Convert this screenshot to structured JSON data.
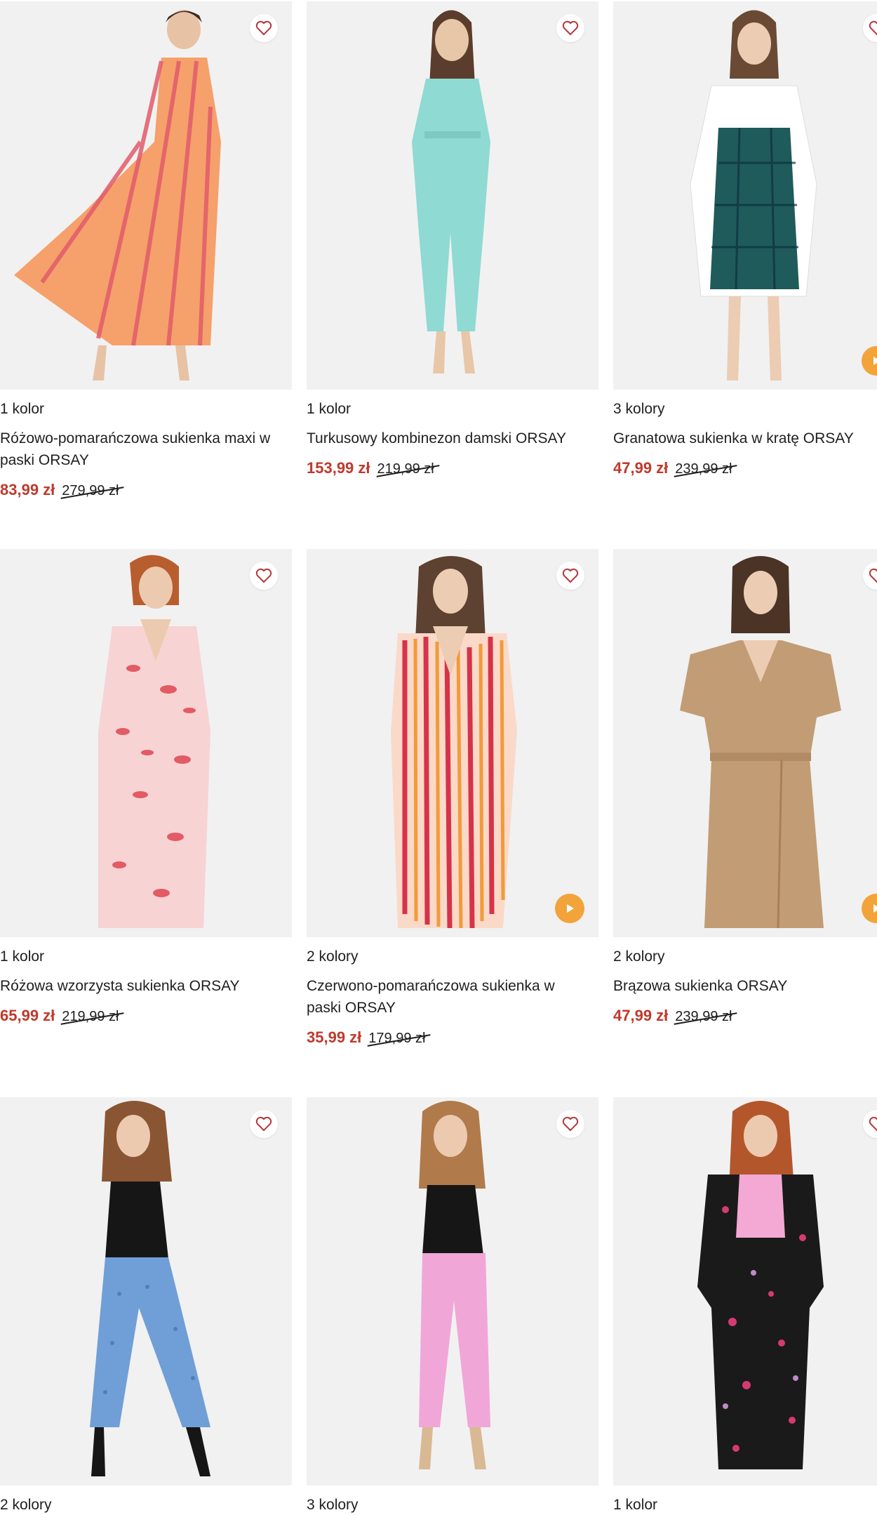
{
  "products": [
    {
      "colors": "1 kolor",
      "name": "Różowo-pomarańczowa sukienka maxi w paski ORSAY",
      "price": "83,99 zł",
      "old_price": "279,99 zł",
      "icon": "heart-icon",
      "has_video": false
    },
    {
      "colors": "1 kolor",
      "name": "Turkusowy kombinezon damski ORSAY",
      "price": "153,99 zł",
      "old_price": "219,99 zł",
      "icon": "heart-icon",
      "has_video": false
    },
    {
      "colors": "3 kolory",
      "name": "Granatowa sukienka w kratę ORSAY",
      "price": "47,99 zł",
      "old_price": "239,99 zł",
      "icon": "heart-icon",
      "has_video": true
    },
    {
      "colors": "1 kolor",
      "name": "Różowa wzorzysta sukienka ORSAY",
      "price": "65,99 zł",
      "old_price": "219,99 zł",
      "icon": "heart-icon",
      "has_video": false
    },
    {
      "colors": "2 kolory",
      "name": "Czerwono-pomarańczowa sukienka w paski ORSAY",
      "price": "35,99 zł",
      "old_price": "179,99 zł",
      "icon": "heart-icon",
      "has_video": true
    },
    {
      "colors": "2 kolory",
      "name": "Brązowa sukienka ORSAY",
      "price": "47,99 zł",
      "old_price": "239,99 zł",
      "icon": "heart-icon",
      "has_video": true
    },
    {
      "colors": "2 kolory",
      "name": "",
      "price": "",
      "old_price": "",
      "icon": "heart-icon",
      "has_video": false
    },
    {
      "colors": "3 kolory",
      "name": "",
      "price": "",
      "old_price": "",
      "icon": "heart-icon",
      "has_video": false
    },
    {
      "colors": "1 kolor",
      "name": "",
      "price": "",
      "old_price": "",
      "icon": "heart-icon",
      "has_video": false
    }
  ],
  "theme": {
    "sale_color": "#c0392b",
    "play_color": "#f2a33a",
    "heart_color": "#b5373a"
  }
}
